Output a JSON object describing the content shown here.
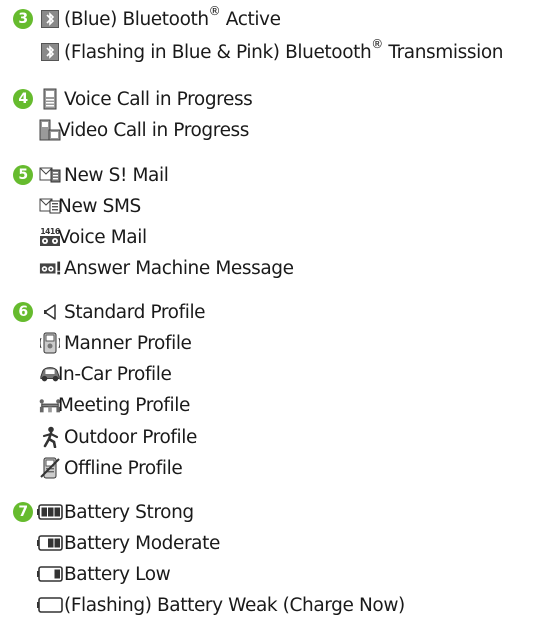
{
  "items": [
    {
      "badge": "3",
      "label_a": "(Blue) Bluetooth",
      "sup": "®",
      "label_b": " Active",
      "icon": "bluetooth-icon"
    },
    {
      "label_a": "(Flashing in Blue & Pink) Bluetooth",
      "sup": "®",
      "label_b": " Transmission",
      "icon": "bluetooth-icon"
    },
    {
      "badge": "4",
      "label": "Voice Call in Progress",
      "icon": "voice-call-icon"
    },
    {
      "label": "Video Call in Progress",
      "icon": "video-call-icon"
    },
    {
      "badge": "5",
      "label": "New S! Mail",
      "icon": "s-mail-icon"
    },
    {
      "label": "New SMS",
      "icon": "sms-icon"
    },
    {
      "label": "Voice Mail",
      "icon": "voice-mail-icon",
      "icon_text": "1416"
    },
    {
      "label": "Answer Machine Message",
      "icon": "answer-machine-icon"
    },
    {
      "badge": "6",
      "label": "Standard Profile",
      "icon": "speaker-icon"
    },
    {
      "label": "Manner Profile",
      "icon": "manner-icon"
    },
    {
      "label": "In-Car Profile",
      "icon": "car-icon"
    },
    {
      "label": "Meeting Profile",
      "icon": "meeting-icon"
    },
    {
      "label": "Outdoor Profile",
      "icon": "outdoor-icon"
    },
    {
      "label": "Offline Profile",
      "icon": "offline-icon"
    },
    {
      "badge": "7",
      "label": "Battery Strong",
      "icon": "battery-strong-icon"
    },
    {
      "label": "Battery Moderate",
      "icon": "battery-moderate-icon"
    },
    {
      "label": "Battery Low",
      "icon": "battery-low-icon"
    },
    {
      "label": "(Flashing) Battery Weak (Charge Now)",
      "icon": "battery-empty-icon"
    }
  ],
  "colors": {
    "badge": "#66bb2e",
    "text": "#1a1a1a",
    "icon": "#333333"
  }
}
